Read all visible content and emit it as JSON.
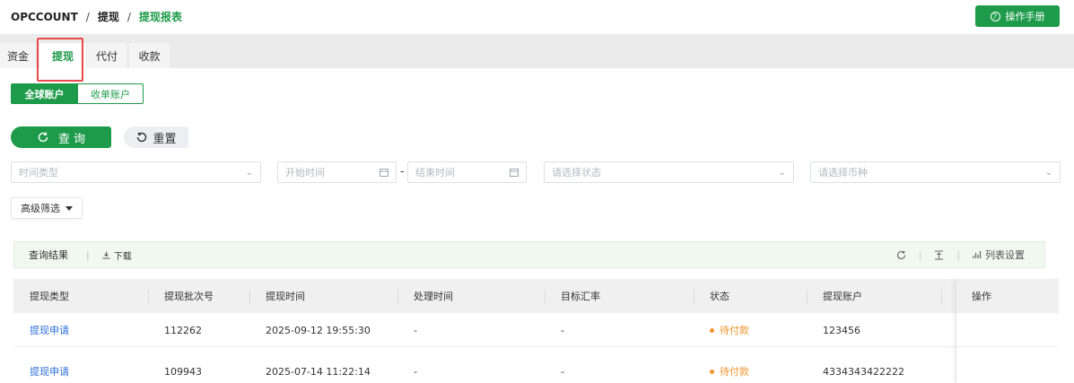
{
  "breadcrumb": [
    "OPCCOUNT",
    "提现",
    "提现报表"
  ],
  "header": {
    "manual_label": "操作手册"
  },
  "tabs": [
    {
      "label": "资金",
      "active": false
    },
    {
      "label": "提现",
      "active": true
    },
    {
      "label": "代付",
      "active": false
    },
    {
      "label": "收款",
      "active": false
    }
  ],
  "segments": {
    "on": "全球账户",
    "off": "收单账户"
  },
  "buttons": {
    "query": "查 询",
    "reset": "重置"
  },
  "filters": {
    "time_type": "时间类型",
    "start_time": "开始时间",
    "end_time": "结束时间",
    "status": "请选择状态",
    "currency": "请选择币种",
    "advanced": "高级筛选"
  },
  "result_bar": {
    "title": "查询结果",
    "download": "下载",
    "column_settings": "列表设置"
  },
  "table": {
    "columns": [
      "提现类型",
      "提现批次号",
      "提现时间",
      "处理时间",
      "目标汇率",
      "状态",
      "提现账户",
      "操作"
    ],
    "rows": [
      {
        "type": "提现申请",
        "batch": "112262",
        "time": "2025-09-12 19:55:30",
        "processed": "-",
        "rate": "-",
        "status": "待付款",
        "account": "123456"
      },
      {
        "type": "提现申请",
        "batch": "109943",
        "time": "2025-07-14 11:22:14",
        "processed": "-",
        "rate": "-",
        "status": "待付款",
        "account": "4334343422222"
      }
    ]
  },
  "colors": {
    "accent": "#1e9b4a",
    "link": "#2c6fd6",
    "pending": "#f0962f",
    "highlight": "#e84a4a"
  }
}
